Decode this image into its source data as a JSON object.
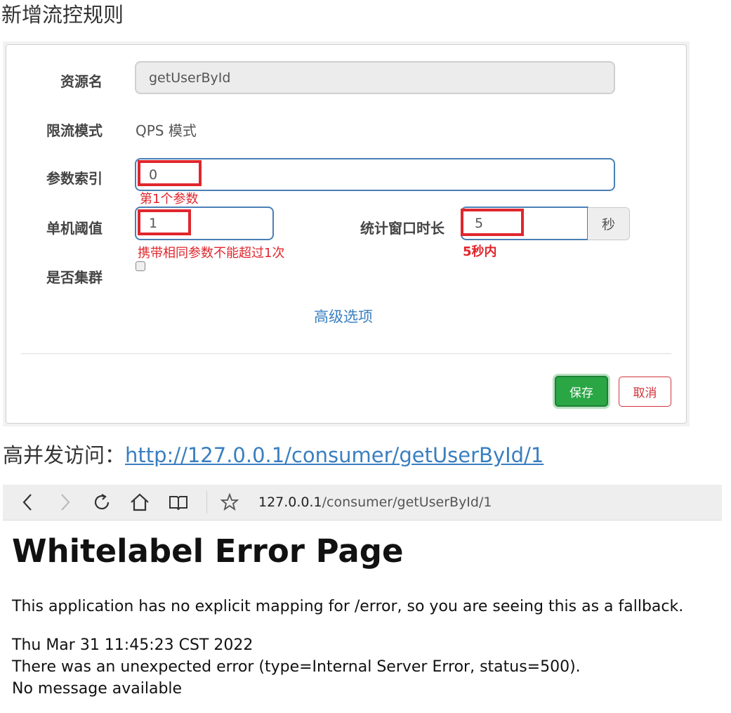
{
  "page_heading": "新增流控规则",
  "form": {
    "resource_label": "资源名",
    "resource_value": "getUserById",
    "mode_label": "限流模式",
    "mode_value": "QPS 模式",
    "param_index_label": "参数索引",
    "param_index_value": "0",
    "param_index_note": "第1个参数",
    "threshold_label": "单机阈值",
    "threshold_value": "1",
    "threshold_note": "携带相同参数不能超过1次",
    "window_label": "统计窗口时长",
    "window_value": "5",
    "window_unit": "秒",
    "window_note": "5秒内",
    "cluster_label": "是否集群",
    "cluster_checked": false,
    "advanced_link": "高级选项",
    "save_label": "保存",
    "cancel_label": "取消"
  },
  "url_line": {
    "prefix": "高并发访问：",
    "url": "http://127.0.0.1/consumer/getUserById/1"
  },
  "browser": {
    "address_host": "127.0.0.1",
    "address_path": "/consumer/getUserById/1",
    "icons": [
      "back-icon",
      "forward-icon",
      "reload-icon",
      "home-icon",
      "reading-view-icon",
      "favorite-star-icon"
    ]
  },
  "error_page": {
    "title": "Whitelabel Error Page",
    "message": "This application has no explicit mapping for /error, so you are seeing this as a fallback.",
    "timestamp": "Thu Mar 31 11:45:23 CST 2022",
    "detail": "There was an unexpected error (type=Internal Server Error, status=500).",
    "note": "No message available"
  },
  "colors": {
    "annotation_red": "#e0262d",
    "link_blue": "#3a7fc0",
    "save_green": "#2aa645",
    "cancel_red": "#d0333a"
  }
}
